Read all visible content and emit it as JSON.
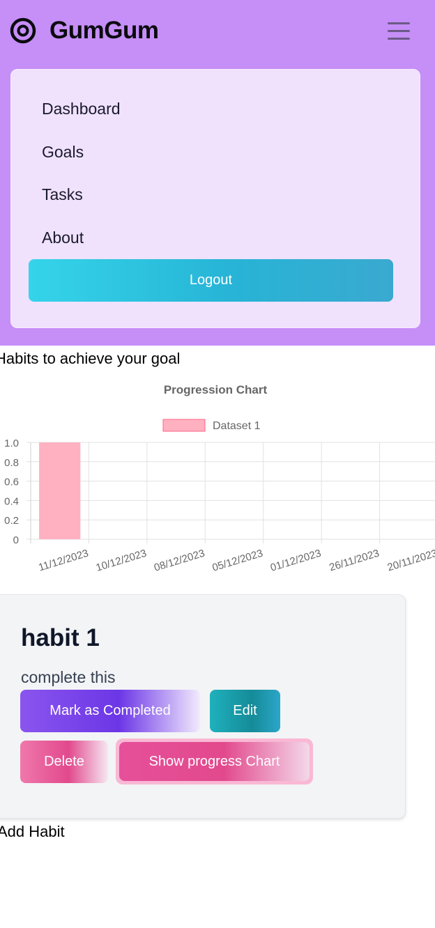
{
  "app": {
    "brand_name": "GumGum",
    "brand_icon": "target-icon",
    "menu_icon": "hamburger-icon"
  },
  "nav": {
    "items": [
      {
        "label": "Dashboard"
      },
      {
        "label": "Goals"
      },
      {
        "label": "Tasks"
      },
      {
        "label": "About"
      }
    ],
    "logout_label": "Logout"
  },
  "main": {
    "heading": "Habits to achieve your goal",
    "add_habit_label": "Add Habit"
  },
  "chart_data": {
    "type": "bar",
    "title": "Progression Chart",
    "categories": [
      "11/12/2023",
      "10/12/2023",
      "08/12/2023",
      "05/12/2023",
      "01/12/2023",
      "26/11/2023",
      "20/11/2023"
    ],
    "series": [
      {
        "name": "Dataset 1",
        "values": [
          1,
          0,
          0,
          0,
          0,
          0,
          0
        ]
      }
    ],
    "ylim": [
      0,
      1.0
    ],
    "yticks": [
      "1.0",
      "0.8",
      "0.6",
      "0.4",
      "0.2",
      "0"
    ],
    "legend_position": "top",
    "grid": true,
    "colors": {
      "bar_fill": "#ffb1c1",
      "bar_border": "#ff6384"
    }
  },
  "habit": {
    "title": "habit 1",
    "description": "complete this",
    "buttons": {
      "complete": "Mark as Completed",
      "edit": "Edit",
      "delete": "Delete",
      "show_chart": "Show progress Chart"
    }
  },
  "colors": {
    "header_bg": "#c68ef7",
    "menu_bg": "#f0e2fc",
    "card_bg": "#f3f4f6"
  }
}
